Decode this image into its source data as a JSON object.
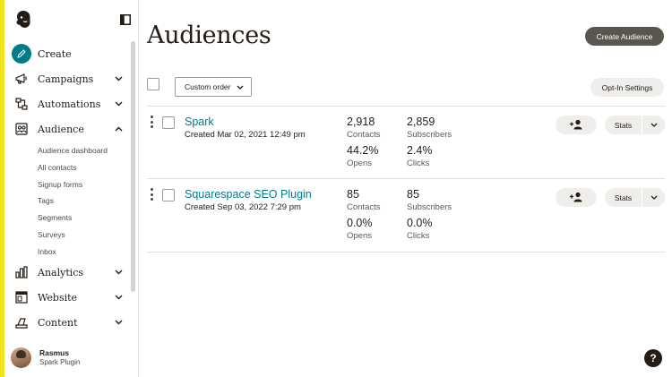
{
  "page": {
    "title": "Audiences"
  },
  "colors": {
    "accent": "#f2e520",
    "brand_teal": "#007c89",
    "dark_button": "#5b5550",
    "light_button": "#efeeea"
  },
  "sidebar": {
    "logo_icon": "mailchimp-freddie-icon",
    "collapse_icon": "sidebar-collapse-icon",
    "items": [
      {
        "label": "Create",
        "icon": "pencil-icon"
      },
      {
        "label": "Campaigns",
        "icon": "megaphone-icon",
        "expanded": false
      },
      {
        "label": "Automations",
        "icon": "workflow-icon",
        "expanded": false
      },
      {
        "label": "Audience",
        "icon": "audience-icon",
        "expanded": true
      },
      {
        "label": "Analytics",
        "icon": "bar-chart-icon",
        "expanded": false
      },
      {
        "label": "Website",
        "icon": "website-icon",
        "expanded": false
      },
      {
        "label": "Content",
        "icon": "content-icon",
        "expanded": false
      }
    ],
    "audience_sub": [
      "Audience dashboard",
      "All contacts",
      "Signup forms",
      "Tags",
      "Segments",
      "Surveys",
      "Inbox"
    ],
    "profile": {
      "name": "Rasmus",
      "account": "Spark Plugin"
    }
  },
  "toolbar": {
    "create_label": "Create Audience",
    "sort_label": "Custom order",
    "optin_label": "Opt-In Settings"
  },
  "audiences": [
    {
      "name": "Spark",
      "created": "Created Mar 02, 2021 12:49 pm",
      "contacts": "2,918",
      "contacts_label": "Contacts",
      "subscribers": "2,859",
      "subscribers_label": "Subscribers",
      "opens": "44.2%",
      "opens_label": "Opens",
      "clicks": "2.4%",
      "clicks_label": "Clicks",
      "stats_label": "Stats"
    },
    {
      "name": "Squarespace SEO Plugin",
      "created": "Created Sep 03, 2022 7:29 pm",
      "contacts": "85",
      "contacts_label": "Contacts",
      "subscribers": "85",
      "subscribers_label": "Subscribers",
      "opens": "0.0%",
      "opens_label": "Opens",
      "clicks": "0.0%",
      "clicks_label": "Clicks",
      "stats_label": "Stats"
    }
  ],
  "help": {
    "label": "?"
  }
}
